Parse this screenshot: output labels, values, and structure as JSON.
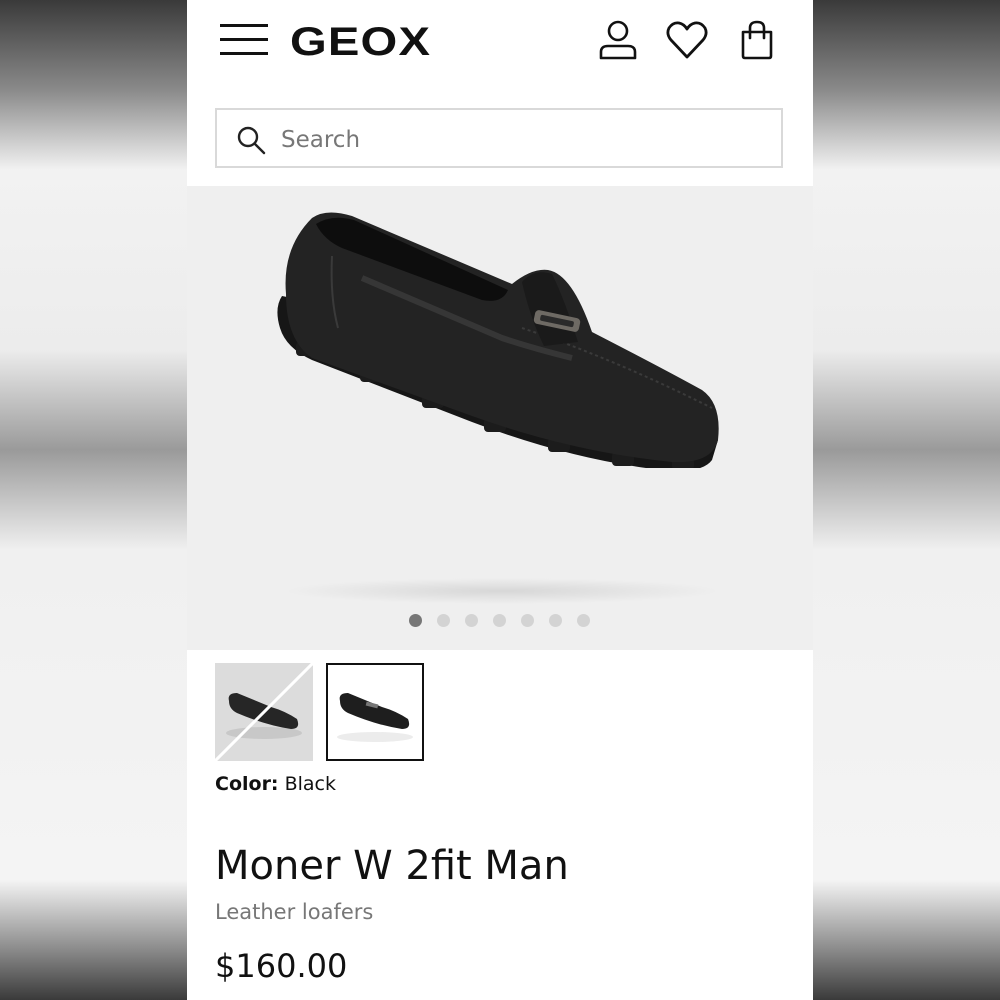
{
  "brand": {
    "name": "GEOX"
  },
  "header": {
    "menu_icon": "hamburger-menu-icon",
    "account_icon": "user-icon",
    "wishlist_icon": "heart-icon",
    "bag_icon": "shopping-bag-icon"
  },
  "search": {
    "placeholder": "Search",
    "value": "",
    "icon": "search-icon"
  },
  "gallery": {
    "image_count": 7,
    "active_index": 0
  },
  "variants": {
    "color_label": "Color:",
    "color_value": "Black",
    "selected_index": 1
  },
  "product": {
    "name": "Moner W 2fit Man",
    "category": "Leather loafers",
    "price": "$160.00"
  },
  "colors": {
    "text": "#111111",
    "muted": "#777777",
    "gallery_bg": "#efefef",
    "dot_active": "#777777",
    "dot_inactive": "#d3d3d3"
  }
}
